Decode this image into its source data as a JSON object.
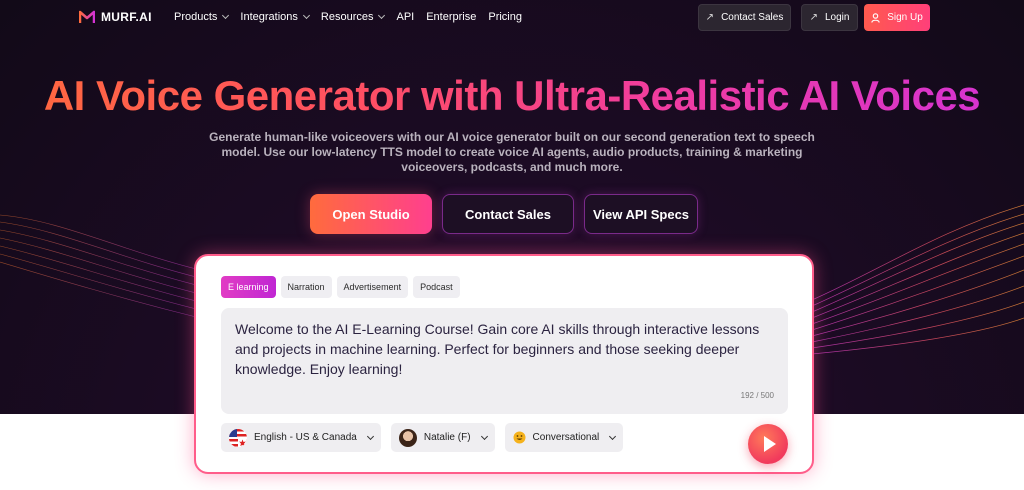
{
  "brand": {
    "name": "MURF.AI"
  },
  "nav": {
    "links": [
      {
        "label": "Products",
        "dropdown": true
      },
      {
        "label": "Integrations",
        "dropdown": true
      },
      {
        "label": "Resources",
        "dropdown": true
      },
      {
        "label": "API",
        "dropdown": false
      },
      {
        "label": "Enterprise",
        "dropdown": false
      },
      {
        "label": "Pricing",
        "dropdown": false
      }
    ],
    "contact_sales": "Contact Sales",
    "login": "Login",
    "signup": "Sign Up"
  },
  "hero": {
    "title": "AI Voice Generator with Ultra-Realistic AI Voices",
    "subtitle": "Generate human-like voiceovers with our AI voice generator built on our second generation text to speech model. Use our low-latency TTS model to create voice AI agents, audio products, training & marketing voiceovers, podcasts, and much more.",
    "cta_primary": "Open Studio",
    "cta_contact": "Contact Sales",
    "cta_api": "View API Specs"
  },
  "demo": {
    "tabs": [
      "E learning",
      "Narration",
      "Advertisement",
      "Podcast"
    ],
    "active_tab": 0,
    "text": "Welcome to the AI E-Learning Course! Gain core AI skills through interactive lessons and projects in machine learning. Perfect for beginners and those seeking deeper knowledge. Enjoy learning!",
    "char_count": "192 / 500",
    "language": "English - US & Canada",
    "voice": "Natalie (F)",
    "style": "Conversational"
  },
  "colors": {
    "accent_orange": "#ff6a3d",
    "accent_pink": "#ff3f7a",
    "accent_magenta": "#d332d6",
    "hero_bg": "#120a18"
  }
}
